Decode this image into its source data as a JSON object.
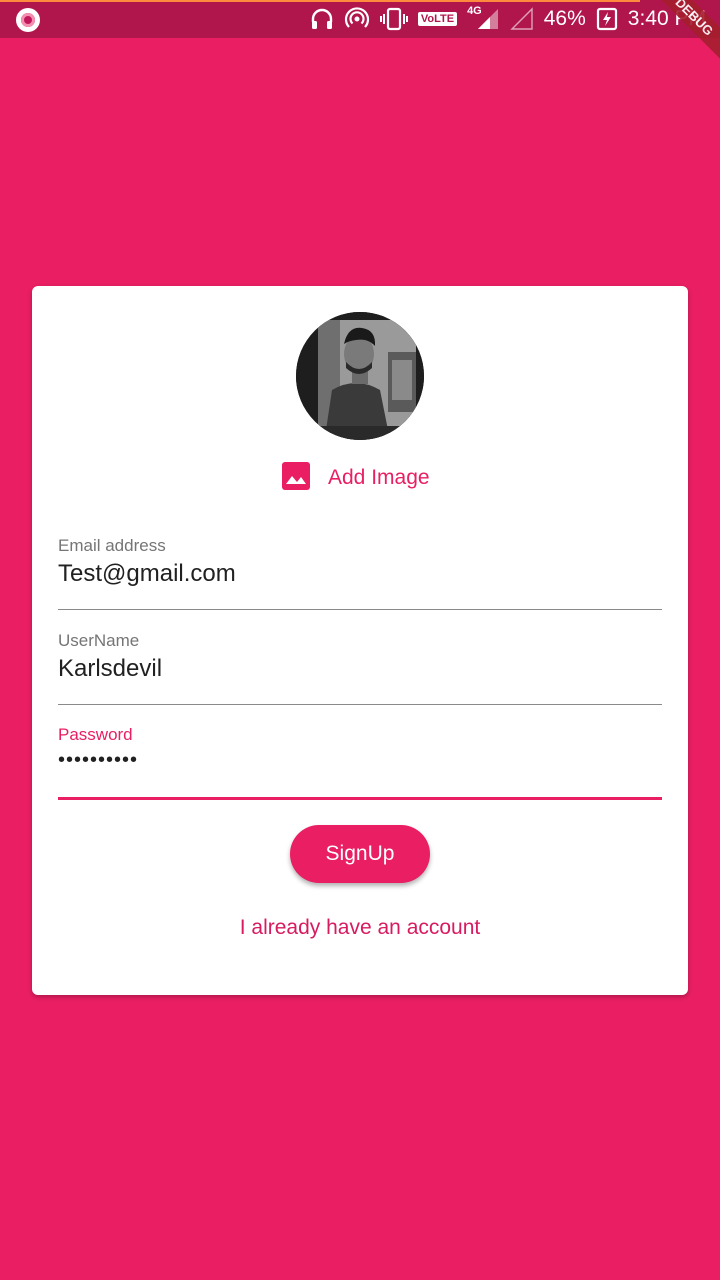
{
  "status_bar": {
    "volte": "VoLTE",
    "network": "4G",
    "battery_percent": "46%",
    "time": "3:40 PM",
    "icons": [
      "record-icon",
      "headphones-icon",
      "hotspot-icon",
      "vibrate-icon",
      "volte-icon",
      "signal-icon",
      "battery-icon"
    ]
  },
  "debug_banner": "DEBUG",
  "form": {
    "add_image_label": "Add Image",
    "email": {
      "label": "Email address",
      "value": "Test@gmail.com"
    },
    "username": {
      "label": "UserName",
      "value": "Karlsdevil"
    },
    "password": {
      "label": "Password",
      "value": "••••••••••"
    },
    "signup_label": "SignUp",
    "login_link": "I already have an account"
  },
  "colors": {
    "background": "#E91E63",
    "status_bar": "#B0164C",
    "accent": "#E91E63",
    "card": "#FFFFFF"
  }
}
